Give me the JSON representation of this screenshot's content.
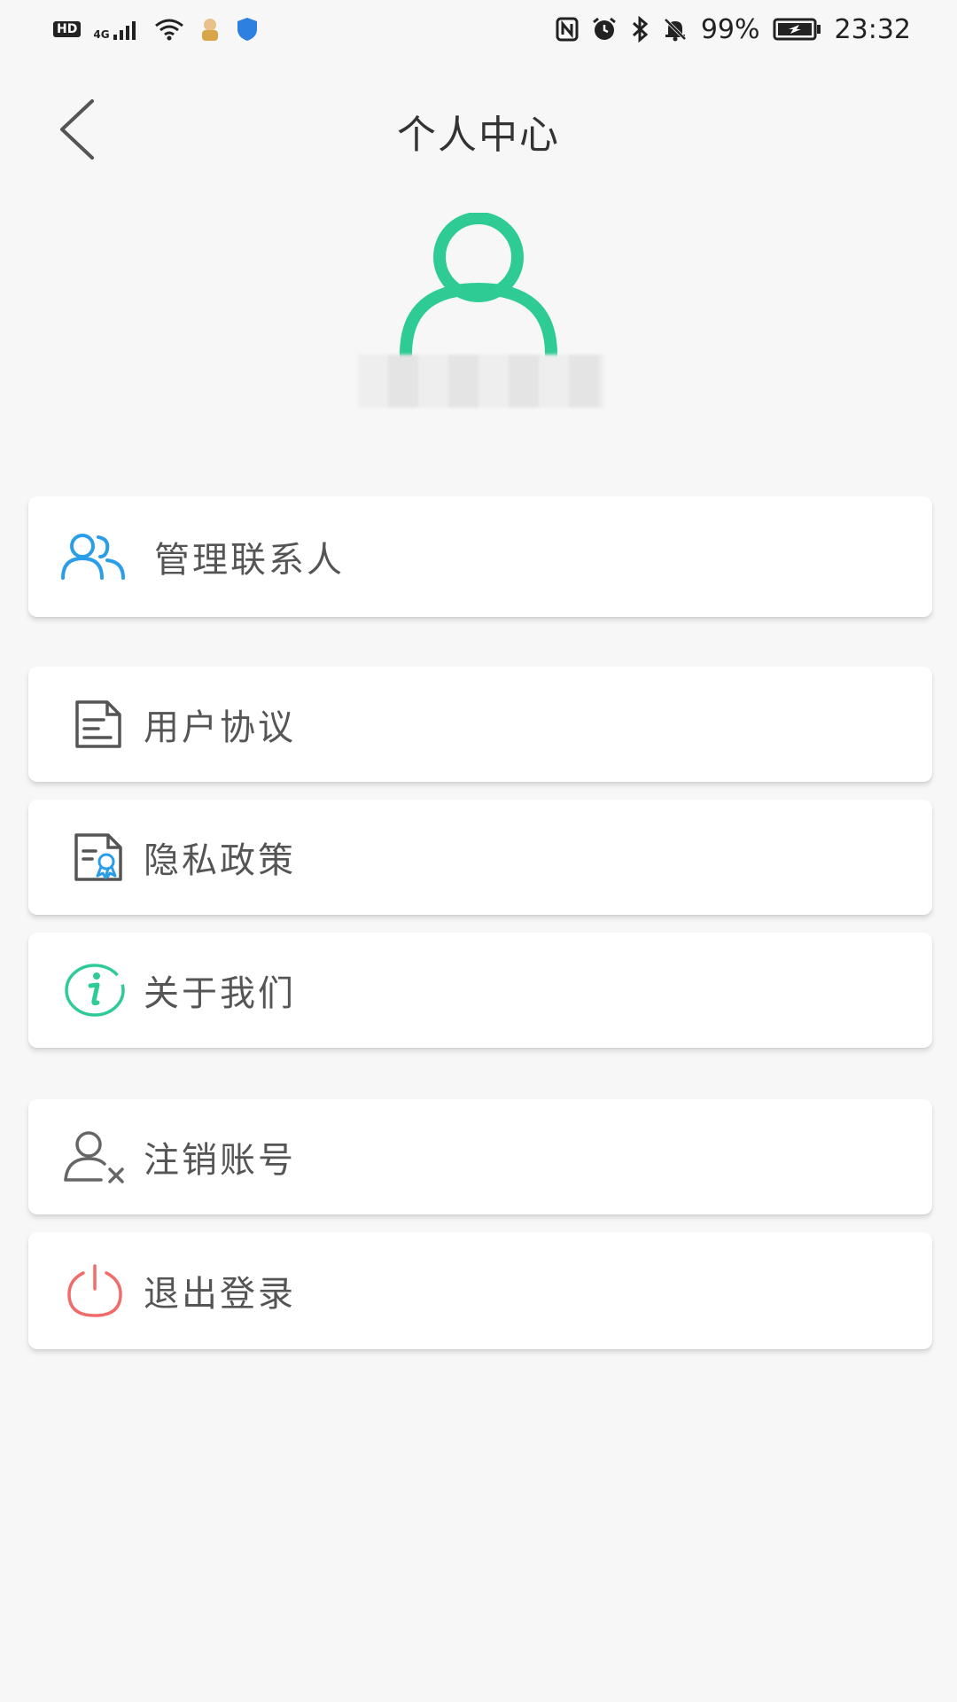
{
  "status_bar": {
    "left_badge": "HD",
    "network": "4G",
    "battery": "99%",
    "time": "23:32"
  },
  "header": {
    "title": "个人中心"
  },
  "profile": {
    "username": "",
    "avatar_color": "#2ecc94"
  },
  "menu": {
    "contacts": {
      "label": "管理联系人",
      "icon": "contacts-icon",
      "color": "#2a9ee8"
    },
    "agreement": {
      "label": "用户协议",
      "icon": "document-icon",
      "color": "#555555"
    },
    "privacy": {
      "label": "隐私政策",
      "icon": "certificate-icon",
      "color": "#2a9ee8"
    },
    "about": {
      "label": "关于我们",
      "icon": "info-icon",
      "color": "#2ecc94"
    },
    "delete_account": {
      "label": "注销账号",
      "icon": "user-remove-icon",
      "color": "#666666"
    },
    "logout": {
      "label": "退出登录",
      "icon": "power-icon",
      "color": "#f26b6b"
    }
  }
}
